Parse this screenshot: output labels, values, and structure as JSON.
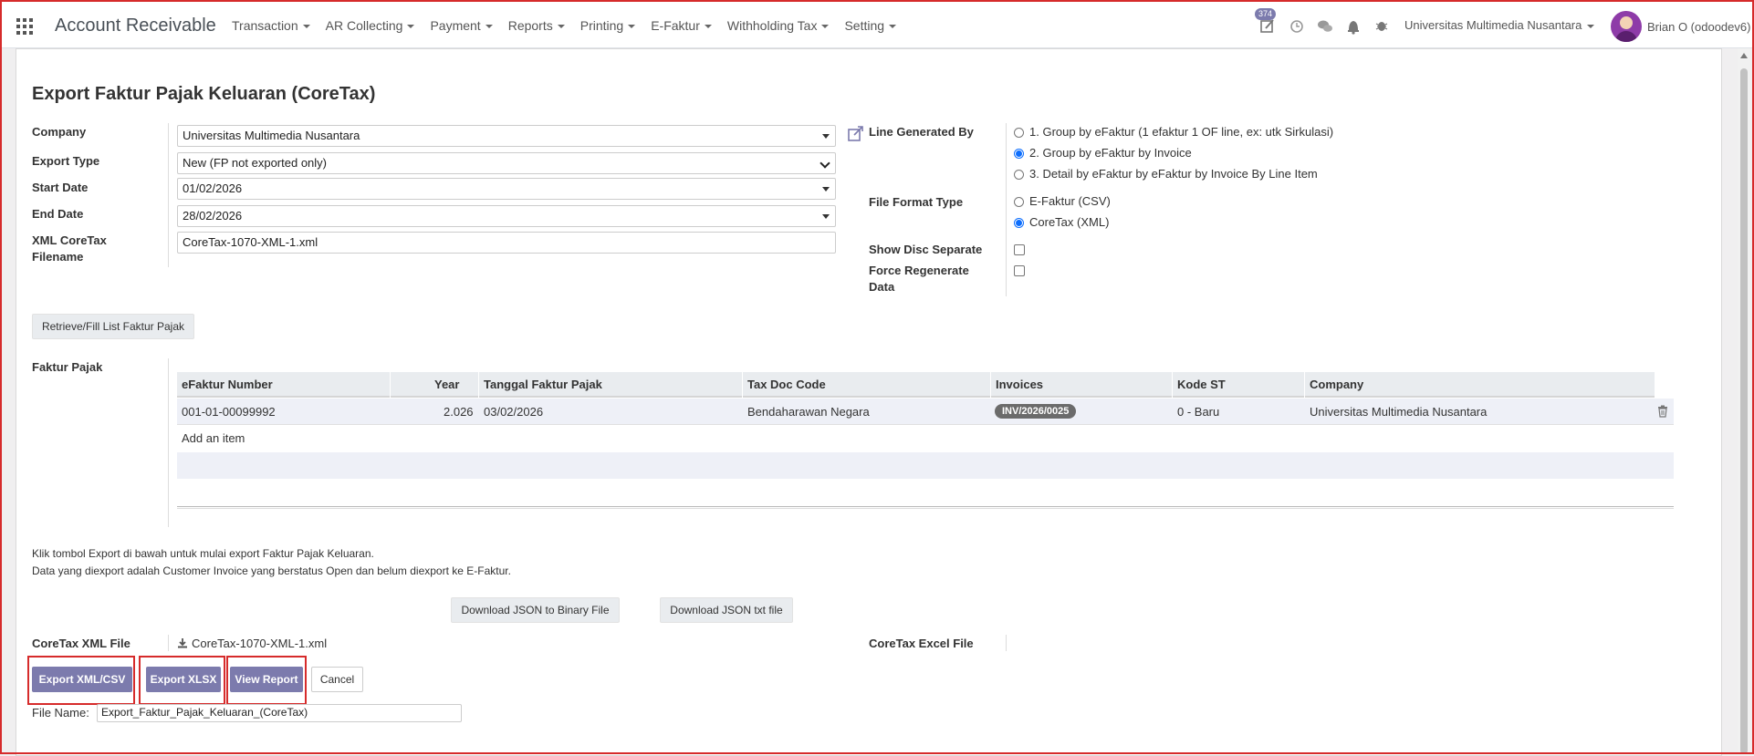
{
  "app": {
    "title": "Account Receivable",
    "menus": [
      "Transaction",
      "AR Collecting",
      "Payment",
      "Reports",
      "Printing",
      "E-Faktur",
      "Withholding Tax",
      "Setting"
    ],
    "activity_badge": "374",
    "company_switcher": "Universitas Multimedia Nusantara",
    "user": "Brian O (odoodev6)"
  },
  "form": {
    "title": "Export Faktur Pajak Keluaran (CoreTax)",
    "labels": {
      "company": "Company",
      "export_type": "Export Type",
      "start_date": "Start Date",
      "end_date": "End Date",
      "xml_filename_1": "XML CoreTax",
      "xml_filename_2": "Filename",
      "line_generated_by": "Line Generated By",
      "file_format_type": "File Format Type",
      "show_disc_separate": "Show Disc Separate",
      "force_regen_1": "Force Regenerate",
      "force_regen_2": "Data",
      "faktur_pajak": "Faktur Pajak",
      "coretax_xml_file": "CoreTax XML File",
      "coretax_excel_file": "CoreTax Excel File",
      "file_name": "File Name:"
    },
    "values": {
      "company": "Universitas Multimedia Nusantara",
      "export_type": "New (FP not exported only)",
      "start_date": "01/02/2026",
      "end_date": "28/02/2026",
      "xml_filename": "CoreTax-1070-XML-1.xml",
      "coretax_xml_link": "CoreTax-1070-XML-1.xml",
      "file_name": "Export_Faktur_Pajak_Keluaran_(CoreTax)"
    },
    "line_generated_options": [
      {
        "label": "1. Group by eFaktur (1 efaktur 1 OF line, ex: utk Sirkulasi)",
        "selected": false
      },
      {
        "label": "2. Group by eFaktur by Invoice",
        "selected": true
      },
      {
        "label": "3. Detail by eFaktur by eFaktur by Invoice By Line Item",
        "selected": false
      }
    ],
    "file_format_options": [
      {
        "label": "E-Faktur (CSV)",
        "selected": false
      },
      {
        "label": "CoreTax (XML)",
        "selected": true
      }
    ],
    "show_disc_separate": false,
    "force_regenerate": false
  },
  "buttons": {
    "retrieve": "Retrieve/Fill List Faktur Pajak",
    "download_json_binary": "Download JSON to Binary File",
    "download_json_txt": "Download JSON txt file",
    "export_xml_csv": "Export XML/CSV",
    "export_xlsx": "Export XLSX",
    "view_report": "View Report",
    "cancel": "Cancel",
    "add_item": "Add an item"
  },
  "table": {
    "columns": [
      "eFaktur Number",
      "Year",
      "Tanggal Faktur Pajak",
      "Tax Doc Code",
      "Invoices",
      "Kode ST",
      "Company"
    ],
    "rows": [
      {
        "efaktur_number": "001-01-00099992",
        "year": "2.026",
        "tanggal": "03/02/2026",
        "tax_doc_code": "Bendaharawan Negara",
        "invoice": "INV/2026/0025",
        "kode_st": "0 - Baru",
        "company": "Universitas Multimedia Nusantara"
      }
    ]
  },
  "info": {
    "line1": "Klik tombol Export di bawah untuk mulai export Faktur Pajak Keluaran.",
    "line2": "Data yang diexport adalah Customer Invoice yang berstatus Open dan belum diexport ke E-Faktur."
  },
  "colors": {
    "primary": "#7c7bad",
    "highlight": "#d62b2b",
    "radio_selected": "#0d6efd"
  }
}
